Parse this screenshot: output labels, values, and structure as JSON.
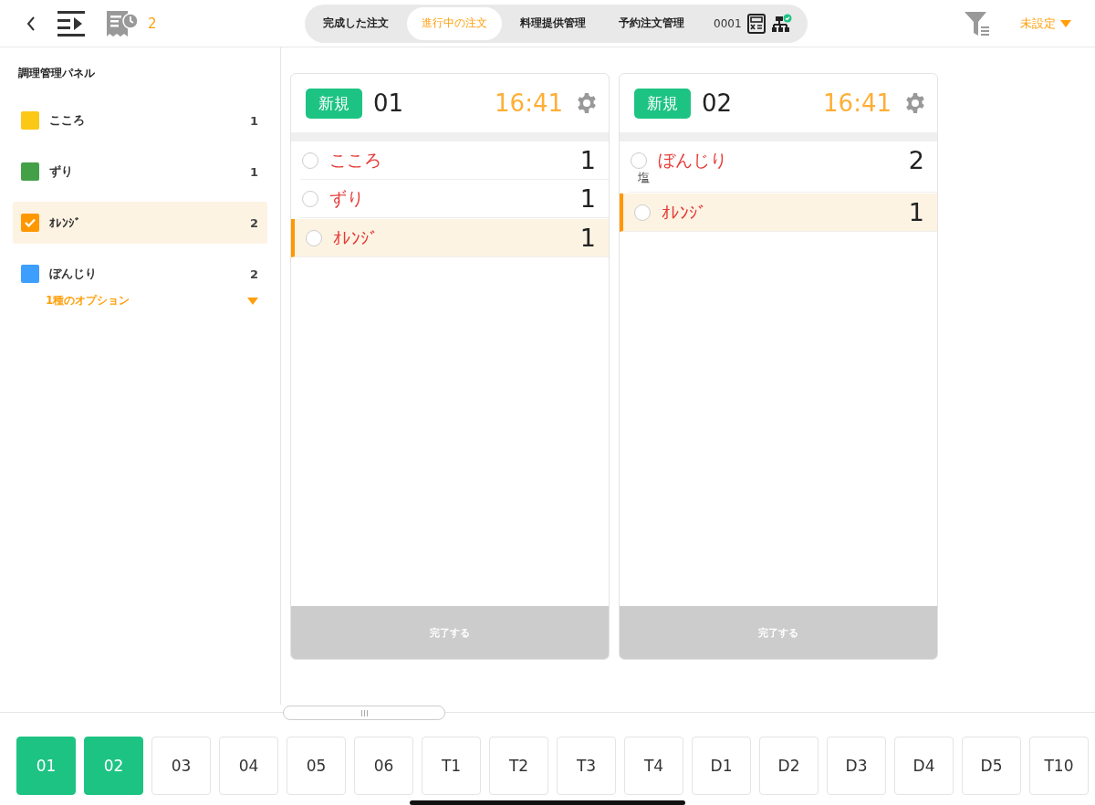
{
  "toolbar": {
    "badge_count": "2",
    "tabs": [
      {
        "label": "完成した注文",
        "selected": false
      },
      {
        "label": "進行中の注文",
        "selected": true
      },
      {
        "label": "料理提供管理",
        "selected": false
      },
      {
        "label": "予約注文管理",
        "selected": false
      }
    ],
    "store_code": "0001",
    "filter_label": "未設定"
  },
  "sidebar": {
    "title": "調理管理パネル",
    "items": [
      {
        "name": "こころ",
        "color": "#fbc816",
        "count": "1",
        "checked": false
      },
      {
        "name": "ずり",
        "color": "#43a047",
        "count": "1",
        "checked": false
      },
      {
        "name": "ｵﾚﾝｼﾞ",
        "color": "#ff9800",
        "count": "2",
        "checked": true
      },
      {
        "name": "ぼんじり",
        "color": "#3d9efe",
        "count": "2",
        "checked": false,
        "options_label": "1種のオプション",
        "expanded": false
      }
    ]
  },
  "orders": [
    {
      "status": "新規",
      "number": "01",
      "time": "16:41",
      "complete_label": "完了する",
      "items": [
        {
          "name": "こころ",
          "qty": "1",
          "highlighted": false,
          "checked": false
        },
        {
          "name": "ずり",
          "qty": "1",
          "highlighted": false,
          "checked": false
        },
        {
          "name": "ｵﾚﾝｼﾞ",
          "qty": "1",
          "highlighted": true,
          "checked": false
        }
      ]
    },
    {
      "status": "新規",
      "number": "02",
      "time": "16:41",
      "complete_label": "完了する",
      "items": [
        {
          "name": "ぼんじり",
          "qty": "2",
          "note": "塩",
          "highlighted": false,
          "checked": false
        },
        {
          "name": "ｵﾚﾝｼﾞ",
          "qty": "1",
          "highlighted": true,
          "checked": false
        }
      ]
    }
  ],
  "tables": [
    {
      "label": "01",
      "selected": true
    },
    {
      "label": "02",
      "selected": true
    },
    {
      "label": "03",
      "selected": false
    },
    {
      "label": "04",
      "selected": false
    },
    {
      "label": "05",
      "selected": false
    },
    {
      "label": "06",
      "selected": false
    },
    {
      "label": "T1",
      "selected": false
    },
    {
      "label": "T2",
      "selected": false
    },
    {
      "label": "T3",
      "selected": false
    },
    {
      "label": "T4",
      "selected": false
    },
    {
      "label": "D1",
      "selected": false
    },
    {
      "label": "D2",
      "selected": false
    },
    {
      "label": "D3",
      "selected": false
    },
    {
      "label": "D4",
      "selected": false
    },
    {
      "label": "D5",
      "selected": false
    },
    {
      "label": "T10",
      "selected": false
    }
  ]
}
